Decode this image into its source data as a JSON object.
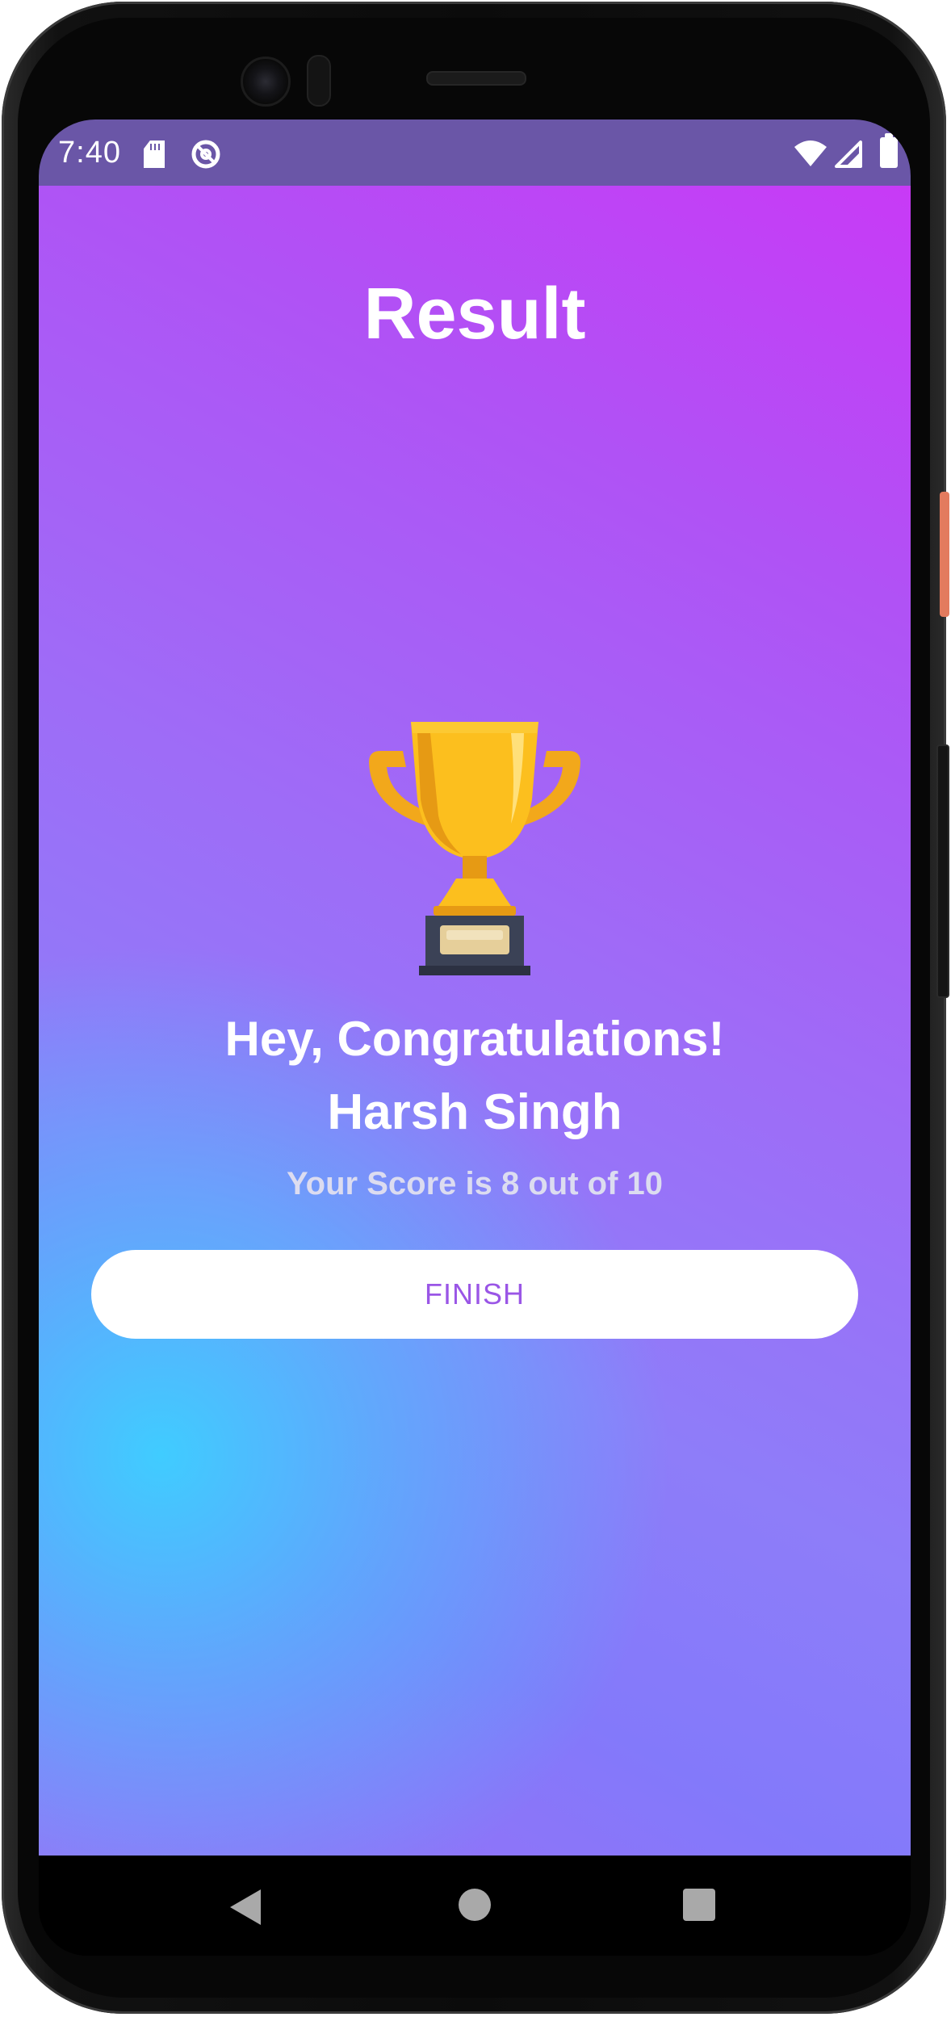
{
  "status_bar": {
    "time": "7:40",
    "icons": [
      "sd-card-icon",
      "do-not-disturb-icon",
      "wifi-icon",
      "signal-icon",
      "battery-icon"
    ]
  },
  "screen": {
    "title": "Result",
    "trophy_icon": "trophy-icon",
    "congrats": "Hey, Congratulations!",
    "user_name": "Harsh Singh",
    "score_text": "Your Score is 8 out of 10",
    "finish_label": "FINISH"
  },
  "nav_bar": {
    "icons": [
      "back-icon",
      "home-icon",
      "recents-icon"
    ]
  },
  "colors": {
    "status_bar": "#6a56a7",
    "gradient_top_right": "#c83af6",
    "gradient_bottom_left": "#40ccff",
    "button_text": "#9a56e6",
    "button_bg": "#ffffff"
  }
}
